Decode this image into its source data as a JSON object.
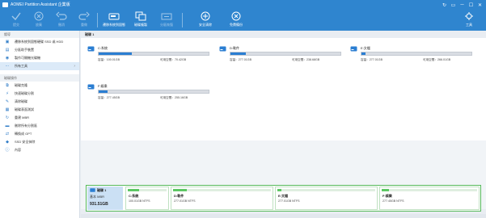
{
  "window": {
    "title": "AOMEI Partition Assistant 企業版",
    "controls": [
      "↻",
      "▭",
      "─",
      "☐",
      "✕"
    ]
  },
  "toolbar": {
    "buttons": [
      {
        "label": "提交",
        "icon": "check-icon",
        "enabled": false
      },
      {
        "label": "放棄",
        "icon": "x-circle-icon",
        "enabled": false
      },
      {
        "label": "撤消",
        "icon": "undo-icon",
        "enabled": false
      },
      {
        "label": "重做",
        "icon": "redo-icon",
        "enabled": false
      },
      {
        "label": "遷移系統到固態",
        "icon": "ssd-migrate-icon",
        "enabled": true
      },
      {
        "label": "磁碟複製",
        "icon": "disk-copy-icon",
        "enabled": true
      },
      {
        "label": "分區恢復",
        "icon": "partition-recovery-icon",
        "enabled": false
      },
      {
        "label": "安全清除",
        "icon": "plus-circle-icon",
        "enabled": true
      },
      {
        "label": "免費備份",
        "icon": "backup-icon",
        "enabled": true
      },
      {
        "label": "工具",
        "icon": "tools-icon",
        "enabled": true
      }
    ]
  },
  "sidebar": {
    "wizard_title": "嚮導",
    "wizard_items": [
      {
        "label": "遷移系統到固態硬碟 SSD 或 HDD",
        "icon": "migrate-icon"
      },
      {
        "label": "分區助手裝置",
        "icon": "partition-icon"
      },
      {
        "label": "製作可開機光碟機",
        "icon": "bootable-icon"
      },
      {
        "label": "所有工具",
        "icon": "tools-icon",
        "has_arrow": true
      }
    ],
    "ops_title": "磁碟操作",
    "ops_items": [
      {
        "label": "磁碟克隆",
        "icon": "clone-icon"
      },
      {
        "label": "快速磁碟分割",
        "icon": "lightning-icon"
      },
      {
        "label": "清除磁碟",
        "icon": "erase-icon"
      },
      {
        "label": "磁碟表面測試",
        "icon": "surface-test-icon"
      },
      {
        "label": "重建 MBR",
        "icon": "rebuild-icon"
      },
      {
        "label": "刪除所有分割區",
        "icon": "delete-all-icon"
      },
      {
        "label": "轉換成 GPT",
        "icon": "convert-icon"
      },
      {
        "label": "SSD 安全抹除",
        "icon": "ssd-erase-icon"
      },
      {
        "label": "內容",
        "icon": "info-icon"
      }
    ]
  },
  "main": {
    "disk_header": "磁碟 1",
    "partitions": [
      {
        "name": "C:系統",
        "capacity_label": "容量：",
        "capacity": "100.01GB",
        "free_label": "可用空間：",
        "free": "70.42GB",
        "used_fraction": 0.3
      },
      {
        "name": "D:軟件",
        "capacity_label": "容量：",
        "capacity": "277.01GB",
        "free_label": "可用空間：",
        "free": "238.68GB",
        "used_fraction": 0.14
      },
      {
        "name": "E:文檔",
        "capacity_label": "容量：",
        "capacity": "277.01GB",
        "free_label": "可用空間：",
        "free": "266.01GB",
        "used_fraction": 0.04
      },
      {
        "name": "F:娛樂",
        "capacity_label": "容量：",
        "capacity": "277.45GB",
        "free_label": "可用空間：",
        "free": "255.16GB",
        "used_fraction": 0.08
      }
    ]
  },
  "disk_map": {
    "disk_name": "磁碟 1",
    "disk_type": "基本 MBR",
    "disk_size": "931.51GB",
    "partitions": [
      {
        "name": "C:系統",
        "info": "100.01GB NTFS",
        "used_fraction": 0.3
      },
      {
        "name": "D:軟件",
        "info": "277.01GB NTFS",
        "used_fraction": 0.14
      },
      {
        "name": "E:文檔",
        "info": "277.01GB NTFS",
        "used_fraction": 0.04
      },
      {
        "name": "F:娛樂",
        "info": "277.45GB NTFS",
        "used_fraction": 0.08
      }
    ]
  },
  "colors": {
    "titlebar": "#2f85cf",
    "bar_fill": "#2b7ed2",
    "map_fill": "#5cc763",
    "map_border": "#55b95a"
  }
}
